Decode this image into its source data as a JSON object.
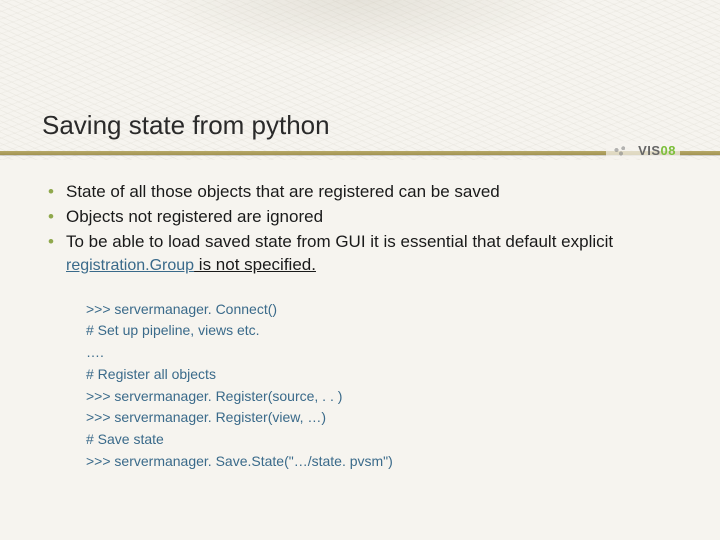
{
  "slide": {
    "title": "Saving state from python",
    "logo": {
      "text_main": "VIS",
      "text_accent": "08"
    },
    "bullets": [
      {
        "text": "State of all those objects that are registered can be saved"
      },
      {
        "text": "Objects not registered are ignored"
      },
      {
        "prefix": "To be able to load saved state from GUI it is essential that default explicit ",
        "code": "registration.Group",
        "suffix": " is not specified."
      }
    ],
    "code": [
      ">>> servermanager. Connect()",
      "# Set up pipeline, views etc.",
      "….",
      "# Register all objects",
      ">>> servermanager. Register(source, . . )",
      ">>> servermanager. Register(view, …)",
      "# Save state",
      ">>> servermanager. Save.State(\"…/state. pvsm\")"
    ]
  }
}
